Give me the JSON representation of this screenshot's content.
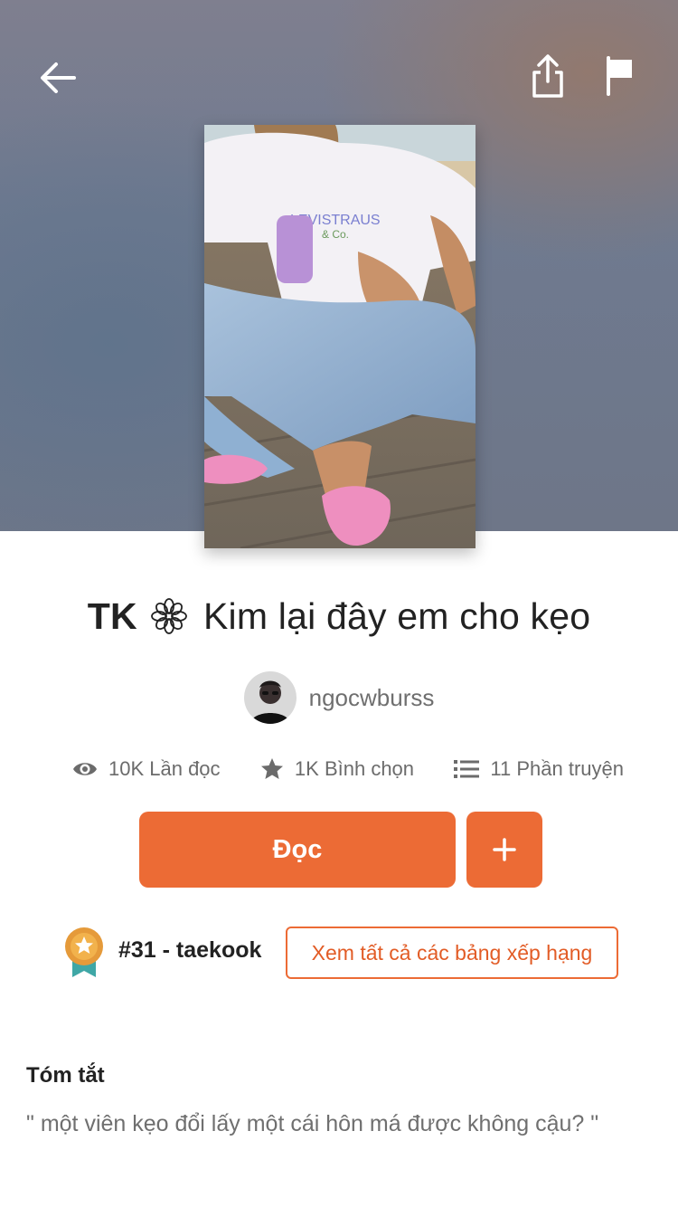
{
  "header": {
    "back_icon": "arrow-left-icon",
    "share_icon": "share-icon",
    "report_icon": "flag-icon"
  },
  "story": {
    "title_prefix": "TK",
    "title_main": "Kim lại đây em cho kẹo",
    "title_symbol_icon": "flower-icon",
    "author": "ngocwburss"
  },
  "stats": {
    "reads": "10K Lần đọc",
    "votes": "1K Bình chọn",
    "parts": "11 Phần truyện"
  },
  "actions": {
    "read_label": "Đọc",
    "add_label": "+"
  },
  "ranking": {
    "rank_text": "#31 - taekook",
    "view_all_label": "Xem tất cả các bảng xếp hạng"
  },
  "summary": {
    "heading": "Tóm tắt",
    "text": "\" một viên kẹo đổi lấy một cái hôn má được không cậu? \""
  },
  "colors": {
    "accent": "#ec6b35",
    "text_dark": "#222222",
    "text_muted": "#6f6f6f"
  }
}
